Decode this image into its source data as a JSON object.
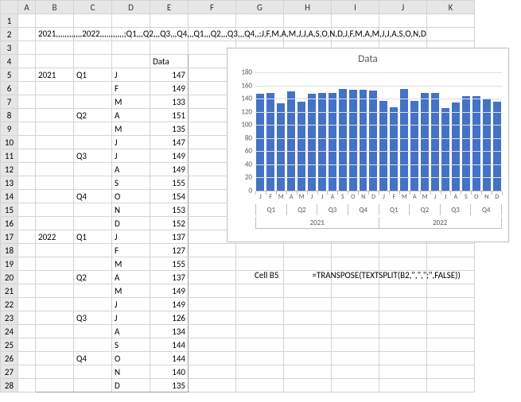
{
  "columns": [
    "A",
    "B",
    "C",
    "D",
    "E",
    "F",
    "G",
    "H",
    "I",
    "J",
    "K"
  ],
  "cell_b2": "2021,,,,,,,,,,,,2022,,,,,,,,,,,;Q1,,,Q2,,,Q3,,,Q4,,,Q1,,,Q2,,,Q3,,,Q4,,;J,F,M,A,M,J,J,A,S,O,N,D,J,F,M,A,M,J,J,A,S,O,N,D",
  "table_header_e4": "Data",
  "table": [
    {
      "row": 5,
      "year": "2021",
      "q": "Q1",
      "m": "J",
      "val": 147
    },
    {
      "row": 6,
      "year": "",
      "q": "",
      "m": "F",
      "val": 149
    },
    {
      "row": 7,
      "year": "",
      "q": "",
      "m": "M",
      "val": 133
    },
    {
      "row": 8,
      "year": "",
      "q": "Q2",
      "m": "A",
      "val": 151
    },
    {
      "row": 9,
      "year": "",
      "q": "",
      "m": "M",
      "val": 135
    },
    {
      "row": 10,
      "year": "",
      "q": "",
      "m": "J",
      "val": 147
    },
    {
      "row": 11,
      "year": "",
      "q": "Q3",
      "m": "J",
      "val": 149
    },
    {
      "row": 12,
      "year": "",
      "q": "",
      "m": "A",
      "val": 149
    },
    {
      "row": 13,
      "year": "",
      "q": "",
      "m": "S",
      "val": 155
    },
    {
      "row": 14,
      "year": "",
      "q": "Q4",
      "m": "O",
      "val": 154
    },
    {
      "row": 15,
      "year": "",
      "q": "",
      "m": "N",
      "val": 153
    },
    {
      "row": 16,
      "year": "",
      "q": "",
      "m": "D",
      "val": 152
    },
    {
      "row": 17,
      "year": "2022",
      "q": "Q1",
      "m": "J",
      "val": 137
    },
    {
      "row": 18,
      "year": "",
      "q": "",
      "m": "F",
      "val": 127
    },
    {
      "row": 19,
      "year": "",
      "q": "",
      "m": "M",
      "val": 155
    },
    {
      "row": 20,
      "year": "",
      "q": "Q2",
      "m": "A",
      "val": 137
    },
    {
      "row": 21,
      "year": "",
      "q": "",
      "m": "M",
      "val": 149
    },
    {
      "row": 22,
      "year": "",
      "q": "",
      "m": "J",
      "val": 149
    },
    {
      "row": 23,
      "year": "",
      "q": "Q3",
      "m": "J",
      "val": 126
    },
    {
      "row": 24,
      "year": "",
      "q": "",
      "m": "A",
      "val": 134
    },
    {
      "row": 25,
      "year": "",
      "q": "",
      "m": "S",
      "val": 144
    },
    {
      "row": 26,
      "year": "",
      "q": "Q4",
      "m": "O",
      "val": 144
    },
    {
      "row": 27,
      "year": "",
      "q": "",
      "m": "N",
      "val": 140
    },
    {
      "row": 28,
      "year": "",
      "q": "",
      "m": "D",
      "val": 135
    }
  ],
  "formula_label": "Cell B5",
  "formula_text": "=TRANSPOSE(TEXTSPLIT(B2,\",\",\";\",FALSE))",
  "chart_data": {
    "type": "bar",
    "title": "Data",
    "ylabel": "",
    "xlabel": "",
    "ylim": [
      0,
      180
    ],
    "yticks": [
      0,
      20,
      40,
      60,
      80,
      100,
      120,
      140,
      160,
      180
    ],
    "categories_year": [
      "2021",
      "2022"
    ],
    "categories_quarter": [
      "Q1",
      "Q2",
      "Q3",
      "Q4",
      "Q1",
      "Q2",
      "Q3",
      "Q4"
    ],
    "categories_month": [
      "J",
      "F",
      "M",
      "A",
      "M",
      "J",
      "J",
      "A",
      "S",
      "O",
      "N",
      "D",
      "J",
      "F",
      "M",
      "A",
      "M",
      "J",
      "J",
      "A",
      "S",
      "O",
      "N",
      "D"
    ],
    "values": [
      147,
      149,
      133,
      151,
      135,
      147,
      149,
      149,
      155,
      154,
      153,
      152,
      137,
      127,
      155,
      137,
      149,
      149,
      126,
      134,
      144,
      144,
      140,
      135
    ]
  }
}
